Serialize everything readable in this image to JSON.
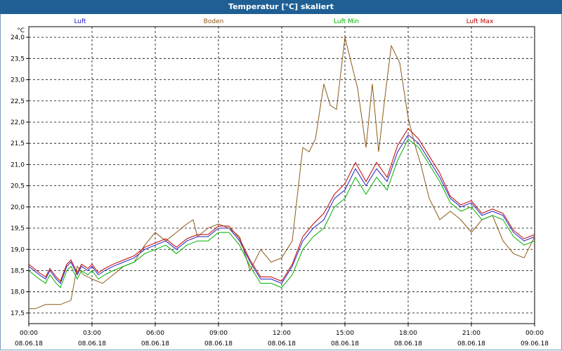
{
  "window": {
    "title": "Temperatur [°C] skaliert"
  },
  "chart_data": {
    "type": "line",
    "title": "Temperatur [°C] skaliert",
    "ylabel": "°C",
    "xlabel": "",
    "ylim": [
      17.25,
      24.25
    ],
    "xlim": [
      0,
      24
    ],
    "yticks": [
      "17,5",
      "18,0",
      "18,5",
      "19,0",
      "19,5",
      "20,0",
      "20,5",
      "21,0",
      "21,5",
      "22,0",
      "22,5",
      "23,0",
      "23,5",
      "24,0"
    ],
    "xticks": [
      {
        "time": "00:00",
        "date": "08.06.18"
      },
      {
        "time": "03:00",
        "date": "08.06.18"
      },
      {
        "time": "06:00",
        "date": "08.06.18"
      },
      {
        "time": "09:00",
        "date": "08.06.18"
      },
      {
        "time": "12:00",
        "date": "08.06.18"
      },
      {
        "time": "15:00",
        "date": "08.06.18"
      },
      {
        "time": "18:00",
        "date": "08.06.18"
      },
      {
        "time": "21:00",
        "date": "08.06.18"
      },
      {
        "time": "00:00",
        "date": "09.06.18"
      }
    ],
    "grid": true,
    "legend_position": "top",
    "series": [
      {
        "name": "Luft",
        "color": "#2020c0",
        "x": [
          0,
          0.5,
          0.8,
          1,
          1.3,
          1.5,
          1.8,
          2,
          2.3,
          2.5,
          2.8,
          3,
          3.3,
          3.6,
          4,
          4.5,
          5,
          5.5,
          6,
          6.5,
          7,
          7.5,
          8,
          8.5,
          9,
          9.5,
          10,
          10.5,
          11,
          11.5,
          12,
          12.5,
          13,
          13.5,
          14,
          14.5,
          15,
          15.5,
          16,
          16.5,
          17,
          17.5,
          18,
          18.5,
          19,
          19.5,
          20,
          20.5,
          21,
          21.5,
          22,
          22.5,
          23,
          23.5,
          24
        ],
        "y": [
          18.6,
          18.4,
          18.3,
          18.5,
          18.3,
          18.2,
          18.6,
          18.7,
          18.4,
          18.6,
          18.5,
          18.6,
          18.4,
          18.5,
          18.6,
          18.7,
          18.8,
          19.0,
          19.1,
          19.2,
          19.0,
          19.2,
          19.3,
          19.3,
          19.5,
          19.5,
          19.2,
          18.7,
          18.3,
          18.3,
          18.2,
          18.6,
          19.2,
          19.5,
          19.7,
          20.2,
          20.4,
          20.9,
          20.5,
          20.9,
          20.6,
          21.3,
          21.7,
          21.5,
          21.1,
          20.7,
          20.2,
          20.0,
          20.1,
          19.8,
          19.9,
          19.8,
          19.4,
          19.2,
          19.3
        ]
      },
      {
        "name": "Boden",
        "color": "#8b5a18",
        "x": [
          0,
          0.3,
          0.8,
          1.5,
          2,
          2.3,
          2.6,
          3,
          3.5,
          4,
          4.5,
          5,
          5.5,
          6,
          6.5,
          7,
          7.5,
          7.8,
          8,
          8.5,
          9,
          9.5,
          10,
          10.5,
          11,
          11.5,
          12,
          12.5,
          13,
          13.3,
          13.6,
          14,
          14.3,
          14.6,
          15,
          15.3,
          15.6,
          16,
          16.3,
          16.6,
          16.9,
          17.2,
          17.6,
          18,
          18.3,
          18.6,
          19,
          19.5,
          20,
          20.5,
          21,
          21.5,
          22,
          22.5,
          23,
          23.5,
          24
        ],
        "y": [
          17.6,
          17.6,
          17.7,
          17.7,
          17.8,
          18.6,
          18.4,
          18.3,
          18.2,
          18.4,
          18.6,
          18.7,
          19.1,
          19.4,
          19.2,
          19.4,
          19.6,
          19.7,
          19.3,
          19.5,
          19.6,
          19.5,
          19.3,
          18.5,
          19.0,
          18.7,
          18.8,
          19.2,
          21.4,
          21.3,
          21.6,
          22.9,
          22.4,
          22.3,
          24.0,
          23.4,
          22.8,
          21.4,
          22.9,
          21.3,
          22.6,
          23.8,
          23.4,
          22.1,
          21.5,
          21.0,
          20.2,
          19.7,
          19.9,
          19.7,
          19.4,
          19.7,
          19.8,
          19.2,
          18.9,
          18.8,
          19.3
        ]
      },
      {
        "name": "Luft Min",
        "color": "#00b000",
        "x": [
          0,
          0.5,
          0.8,
          1,
          1.3,
          1.5,
          1.8,
          2,
          2.3,
          2.5,
          2.8,
          3,
          3.3,
          3.6,
          4,
          4.5,
          5,
          5.5,
          6,
          6.5,
          7,
          7.5,
          8,
          8.5,
          9,
          9.5,
          10,
          10.5,
          11,
          11.5,
          12,
          12.5,
          13,
          13.5,
          14,
          14.5,
          15,
          15.5,
          16,
          16.5,
          17,
          17.5,
          18,
          18.5,
          19,
          19.5,
          20,
          20.5,
          21,
          21.5,
          22,
          22.5,
          23,
          23.5,
          24
        ],
        "y": [
          18.5,
          18.3,
          18.2,
          18.4,
          18.2,
          18.1,
          18.5,
          18.6,
          18.3,
          18.5,
          18.4,
          18.5,
          18.3,
          18.4,
          18.5,
          18.6,
          18.7,
          18.9,
          19.0,
          19.1,
          18.9,
          19.1,
          19.2,
          19.2,
          19.4,
          19.4,
          19.1,
          18.6,
          18.2,
          18.2,
          18.1,
          18.4,
          19.0,
          19.3,
          19.5,
          20.0,
          20.2,
          20.7,
          20.3,
          20.7,
          20.4,
          21.1,
          21.6,
          21.4,
          21.0,
          20.6,
          20.1,
          19.9,
          20.0,
          19.7,
          19.8,
          19.7,
          19.3,
          19.1,
          19.2
        ]
      },
      {
        "name": "Luft Max",
        "color": "#c00000",
        "x": [
          0,
          0.5,
          0.8,
          1,
          1.3,
          1.5,
          1.8,
          2,
          2.3,
          2.5,
          2.8,
          3,
          3.3,
          3.6,
          4,
          4.5,
          5,
          5.5,
          6,
          6.5,
          7,
          7.5,
          8,
          8.5,
          9,
          9.5,
          10,
          10.5,
          11,
          11.5,
          12,
          12.5,
          13,
          13.5,
          14,
          14.5,
          15,
          15.5,
          16,
          16.5,
          17,
          17.5,
          18,
          18.5,
          19,
          19.5,
          20,
          20.5,
          21,
          21.5,
          22,
          22.5,
          23,
          23.5,
          24
        ],
        "y": [
          18.65,
          18.45,
          18.35,
          18.55,
          18.35,
          18.25,
          18.65,
          18.75,
          18.45,
          18.65,
          18.55,
          18.65,
          18.45,
          18.55,
          18.65,
          18.75,
          18.85,
          19.05,
          19.15,
          19.25,
          19.05,
          19.25,
          19.35,
          19.35,
          19.55,
          19.55,
          19.25,
          18.75,
          18.35,
          18.35,
          18.25,
          18.65,
          19.3,
          19.6,
          19.85,
          20.3,
          20.55,
          21.05,
          20.6,
          21.05,
          20.7,
          21.45,
          21.85,
          21.6,
          21.2,
          20.8,
          20.25,
          20.05,
          20.15,
          19.85,
          19.95,
          19.85,
          19.45,
          19.25,
          19.35
        ]
      }
    ]
  }
}
